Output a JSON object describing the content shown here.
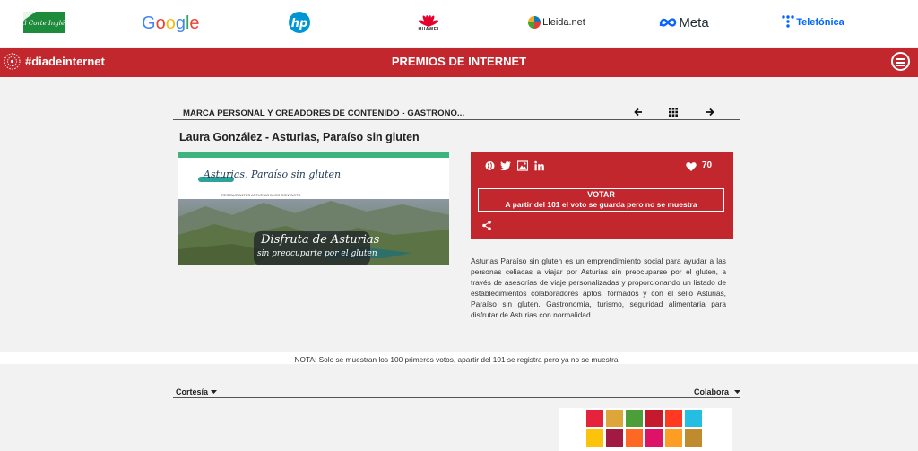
{
  "sponsors": {
    "google": "Google",
    "huawei": "HUAWEI",
    "lleida": "Lleida.net",
    "meta": "Meta",
    "telefonica": "Telefónica",
    "elcorte_alt": "El Corte Inglés",
    "hp_alt": "hp"
  },
  "header": {
    "hashtag": "#diadeinternet",
    "title": "PREMIOS DE INTERNET"
  },
  "award": {
    "category": "MARCA PERSONAL Y CREADORES DE CONTENIDO -   GASTRONO...",
    "title": "Laura González - Asturias, Paraíso sin gluten",
    "likes": "70",
    "vote_label": "VOTAR",
    "vote_note": "A partir del 101 el voto se guarda pero no se muestra",
    "description": "Asturias Paraíso sin gluten es un emprendimiento social para ayudar a las personas celiacas a viajar por Asturias sin preocuparse por el gluten, a través de asesorías de viaje personalizadas y proporcionando un listado de establecimientos colaboradores aptos, formados y con el sello Asturias, Paraíso sin gluten. Gastronomía, turismo, seguridad alimentaria para disfrutar de Asturias con normalidad."
  },
  "preview": {
    "brand": "Asturias, Paraíso sin gluten",
    "caption1": "Disfruta de Asturias",
    "caption2": "sin preocuparte por el gluten",
    "menu": "RESTAURANTES    ASTURIAS    BLOG    CONTACTO"
  },
  "note": "NOTA: Solo se muestran los 100 primeros votos, apartir del 101 se registra pero ya no se muestra",
  "footer": {
    "left": "Cortesía",
    "right": "Colabora"
  },
  "colors": {
    "brand_red": "#c1272d",
    "background": "#f1f2f1"
  }
}
